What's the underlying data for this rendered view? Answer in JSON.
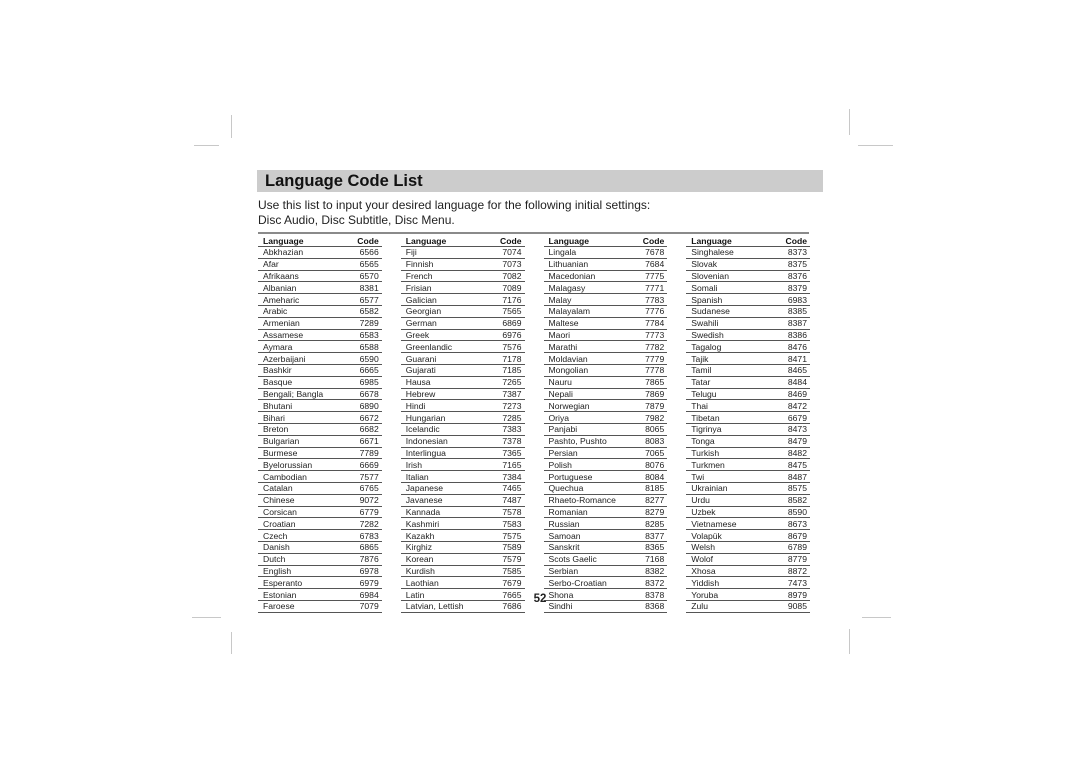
{
  "page": {
    "title": "Language Code List",
    "intro_line1": "Use this list to input your desired language for the following initial settings:",
    "intro_line2": "Disc Audio, Disc Subtitle, Disc Menu.",
    "page_number": "52"
  },
  "table": {
    "header_language": "Language",
    "header_code": "Code",
    "columns": [
      [
        {
          "language": "Abkhazian",
          "code": "6566"
        },
        {
          "language": "Afar",
          "code": "6565"
        },
        {
          "language": "Afrikaans",
          "code": "6570"
        },
        {
          "language": "Albanian",
          "code": "8381"
        },
        {
          "language": "Ameharic",
          "code": "6577"
        },
        {
          "language": "Arabic",
          "code": "6582"
        },
        {
          "language": "Armenian",
          "code": "7289"
        },
        {
          "language": "Assamese",
          "code": "6583"
        },
        {
          "language": "Aymara",
          "code": "6588"
        },
        {
          "language": "Azerbaijani",
          "code": "6590"
        },
        {
          "language": "Bashkir",
          "code": "6665"
        },
        {
          "language": "Basque",
          "code": "6985"
        },
        {
          "language": "Bengali; Bangla",
          "code": "6678"
        },
        {
          "language": "Bhutani",
          "code": "6890"
        },
        {
          "language": "Bihari",
          "code": "6672"
        },
        {
          "language": "Breton",
          "code": "6682"
        },
        {
          "language": "Bulgarian",
          "code": "6671"
        },
        {
          "language": "Burmese",
          "code": "7789"
        },
        {
          "language": "Byelorussian",
          "code": "6669"
        },
        {
          "language": "Cambodian",
          "code": "7577"
        },
        {
          "language": "Catalan",
          "code": "6765"
        },
        {
          "language": "Chinese",
          "code": "9072"
        },
        {
          "language": "Corsican",
          "code": "6779"
        },
        {
          "language": "Croatian",
          "code": "7282"
        },
        {
          "language": "Czech",
          "code": "6783"
        },
        {
          "language": "Danish",
          "code": "6865"
        },
        {
          "language": "Dutch",
          "code": "7876"
        },
        {
          "language": "English",
          "code": "6978"
        },
        {
          "language": "Esperanto",
          "code": "6979"
        },
        {
          "language": "Estonian",
          "code": "6984"
        },
        {
          "language": "Faroese",
          "code": "7079"
        }
      ],
      [
        {
          "language": "Fiji",
          "code": "7074"
        },
        {
          "language": "Finnish",
          "code": "7073"
        },
        {
          "language": "French",
          "code": "7082"
        },
        {
          "language": "Frisian",
          "code": "7089"
        },
        {
          "language": "Galician",
          "code": "7176"
        },
        {
          "language": "Georgian",
          "code": "7565"
        },
        {
          "language": "German",
          "code": "6869"
        },
        {
          "language": "Greek",
          "code": "6976"
        },
        {
          "language": "Greenlandic",
          "code": "7576"
        },
        {
          "language": "Guarani",
          "code": "7178"
        },
        {
          "language": "Gujarati",
          "code": "7185"
        },
        {
          "language": "Hausa",
          "code": "7265"
        },
        {
          "language": "Hebrew",
          "code": "7387"
        },
        {
          "language": "Hindi",
          "code": "7273"
        },
        {
          "language": "Hungarian",
          "code": "7285"
        },
        {
          "language": "Icelandic",
          "code": "7383"
        },
        {
          "language": "Indonesian",
          "code": "7378"
        },
        {
          "language": "Interlingua",
          "code": "7365"
        },
        {
          "language": "Irish",
          "code": "7165"
        },
        {
          "language": "Italian",
          "code": "7384"
        },
        {
          "language": "Japanese",
          "code": "7465"
        },
        {
          "language": "Javanese",
          "code": "7487"
        },
        {
          "language": "Kannada",
          "code": "7578"
        },
        {
          "language": "Kashmiri",
          "code": "7583"
        },
        {
          "language": "Kazakh",
          "code": "7575"
        },
        {
          "language": "Kirghiz",
          "code": "7589"
        },
        {
          "language": "Korean",
          "code": "7579"
        },
        {
          "language": "Kurdish",
          "code": "7585"
        },
        {
          "language": "Laothian",
          "code": "7679"
        },
        {
          "language": "Latin",
          "code": "7665"
        },
        {
          "language": "Latvian, Lettish",
          "code": "7686"
        }
      ],
      [
        {
          "language": "Lingala",
          "code": "7678"
        },
        {
          "language": "Lithuanian",
          "code": "7684"
        },
        {
          "language": "Macedonian",
          "code": "7775"
        },
        {
          "language": "Malagasy",
          "code": "7771"
        },
        {
          "language": "Malay",
          "code": "7783"
        },
        {
          "language": "Malayalam",
          "code": "7776"
        },
        {
          "language": "Maltese",
          "code": "7784"
        },
        {
          "language": "Maori",
          "code": "7773"
        },
        {
          "language": "Marathi",
          "code": "7782"
        },
        {
          "language": "Moldavian",
          "code": "7779"
        },
        {
          "language": "Mongolian",
          "code": "7778"
        },
        {
          "language": "Nauru",
          "code": "7865"
        },
        {
          "language": "Nepali",
          "code": "7869"
        },
        {
          "language": "Norwegian",
          "code": "7879"
        },
        {
          "language": "Oriya",
          "code": "7982"
        },
        {
          "language": "Panjabi",
          "code": "8065"
        },
        {
          "language": "Pashto, Pushto",
          "code": "8083"
        },
        {
          "language": "Persian",
          "code": "7065"
        },
        {
          "language": "Polish",
          "code": "8076"
        },
        {
          "language": "Portuguese",
          "code": "8084"
        },
        {
          "language": "Quechua",
          "code": "8185"
        },
        {
          "language": "Rhaeto-Romance",
          "code": "8277"
        },
        {
          "language": "Romanian",
          "code": "8279"
        },
        {
          "language": "Russian",
          "code": "8285"
        },
        {
          "language": "Samoan",
          "code": "8377"
        },
        {
          "language": "Sanskrit",
          "code": "8365"
        },
        {
          "language": "Scots Gaelic",
          "code": "7168"
        },
        {
          "language": "Serbian",
          "code": "8382"
        },
        {
          "language": "Serbo-Croatian",
          "code": "8372"
        },
        {
          "language": "Shona",
          "code": "8378"
        },
        {
          "language": "Sindhi",
          "code": "8368"
        }
      ],
      [
        {
          "language": "Singhalese",
          "code": "8373"
        },
        {
          "language": "Slovak",
          "code": "8375"
        },
        {
          "language": "Slovenian",
          "code": "8376"
        },
        {
          "language": "Somali",
          "code": "8379"
        },
        {
          "language": "Spanish",
          "code": "6983"
        },
        {
          "language": "Sudanese",
          "code": "8385"
        },
        {
          "language": "Swahili",
          "code": "8387"
        },
        {
          "language": "Swedish",
          "code": "8386"
        },
        {
          "language": "Tagalog",
          "code": "8476"
        },
        {
          "language": "Tajik",
          "code": "8471"
        },
        {
          "language": "Tamil",
          "code": "8465"
        },
        {
          "language": "Tatar",
          "code": "8484"
        },
        {
          "language": "Telugu",
          "code": "8469"
        },
        {
          "language": "Thai",
          "code": "8472"
        },
        {
          "language": "Tibetan",
          "code": "6679"
        },
        {
          "language": "Tigrinya",
          "code": "8473"
        },
        {
          "language": "Tonga",
          "code": "8479"
        },
        {
          "language": "Turkish",
          "code": "8482"
        },
        {
          "language": "Turkmen",
          "code": "8475"
        },
        {
          "language": "Twi",
          "code": "8487"
        },
        {
          "language": "Ukrainian",
          "code": "8575"
        },
        {
          "language": "Urdu",
          "code": "8582"
        },
        {
          "language": "Uzbek",
          "code": "8590"
        },
        {
          "language": "Vietnamese",
          "code": "8673"
        },
        {
          "language": "Volapük",
          "code": "8679"
        },
        {
          "language": "Welsh",
          "code": "6789"
        },
        {
          "language": "Wolof",
          "code": "8779"
        },
        {
          "language": "Xhosa",
          "code": "8872"
        },
        {
          "language": "Yiddish",
          "code": "7473"
        },
        {
          "language": "Yoruba",
          "code": "8979"
        },
        {
          "language": "Zulu",
          "code": "9085"
        }
      ]
    ]
  }
}
